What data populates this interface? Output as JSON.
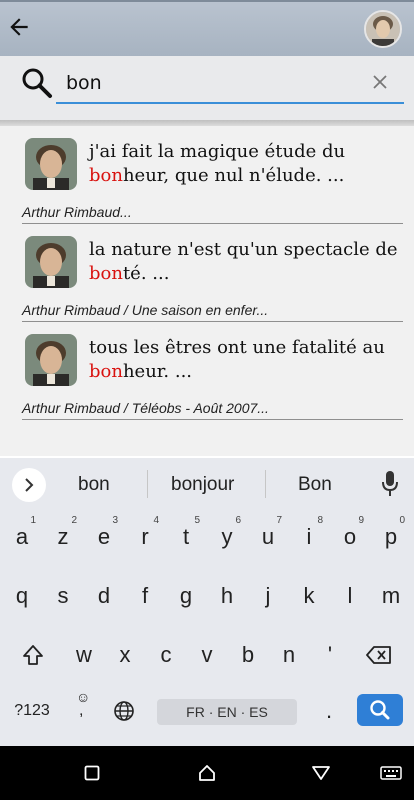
{
  "search": {
    "value": "bon"
  },
  "results": [
    {
      "pre": "j'ai fait la magique étude du ",
      "hl": "bon",
      "post": "heur, que nul n'élude. ...",
      "source": "Arthur Rimbaud..."
    },
    {
      "pre": "la nature n'est qu'un spectacle de ",
      "hl": "bon",
      "post": "té. ...",
      "source": "Arthur Rimbaud / Une saison en enfer..."
    },
    {
      "pre": "tous les êtres ont une fatalité au ",
      "hl": "bon",
      "post": "heur. ...",
      "source": "Arthur Rimbaud / Téléobs - Août 2007..."
    }
  ],
  "keyboard": {
    "suggestions": [
      "bon",
      "bonjour",
      "Bon"
    ],
    "row1": [
      {
        "k": "a",
        "n": "1"
      },
      {
        "k": "z",
        "n": "2"
      },
      {
        "k": "e",
        "n": "3"
      },
      {
        "k": "r",
        "n": "4"
      },
      {
        "k": "t",
        "n": "5"
      },
      {
        "k": "y",
        "n": "6"
      },
      {
        "k": "u",
        "n": "7"
      },
      {
        "k": "i",
        "n": "8"
      },
      {
        "k": "o",
        "n": "9"
      },
      {
        "k": "p",
        "n": "0"
      }
    ],
    "row2": [
      "q",
      "s",
      "d",
      "f",
      "g",
      "h",
      "j",
      "k",
      "l",
      "m"
    ],
    "row3": [
      "w",
      "x",
      "c",
      "v",
      "b",
      "n",
      "'"
    ],
    "symbols_label": "?123",
    "emoji_label": "☺",
    "comma_label": ",",
    "period_label": ".",
    "space_label": "FR · EN · ES"
  },
  "colors": {
    "highlight": "#d9120f",
    "accent": "#3a8fd8",
    "enter": "#2f7fd6"
  }
}
